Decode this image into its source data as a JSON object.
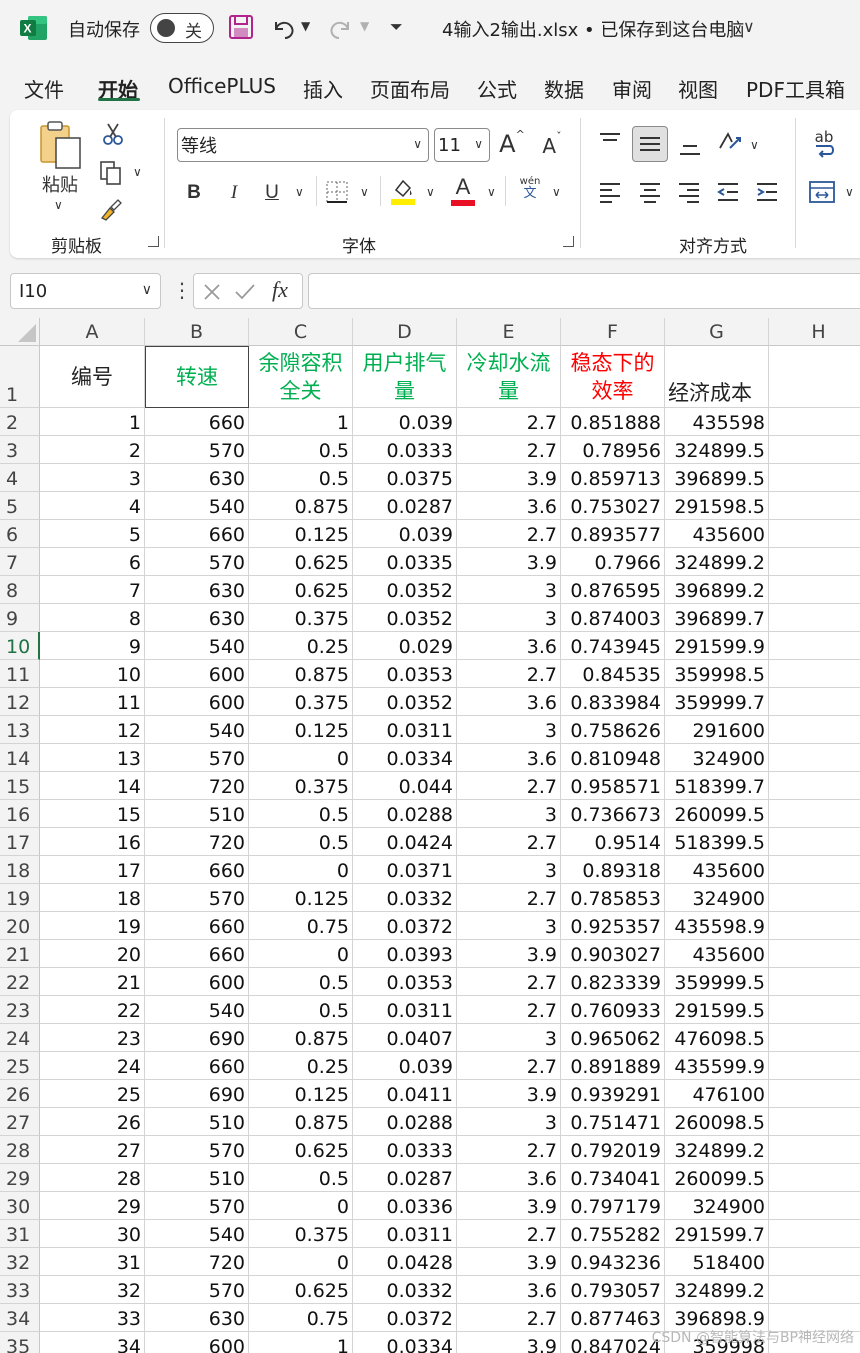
{
  "titlebar": {
    "autosave_label": "自动保存",
    "autosave_state": "关",
    "document_title": "4输入2输出.xlsx • 已保存到这台电脑"
  },
  "tabs": [
    {
      "label": "文件",
      "active": false
    },
    {
      "label": "开始",
      "active": true
    },
    {
      "label": "OfficePLUS",
      "active": false
    },
    {
      "label": "插入",
      "active": false
    },
    {
      "label": "页面布局",
      "active": false
    },
    {
      "label": "公式",
      "active": false
    },
    {
      "label": "数据",
      "active": false
    },
    {
      "label": "审阅",
      "active": false
    },
    {
      "label": "视图",
      "active": false
    },
    {
      "label": "PDF工具箱",
      "active": false
    }
  ],
  "ribbon": {
    "paste_label": "粘贴",
    "clipboard_label": "剪贴板",
    "font_group_label": "字体",
    "align_group_label": "对齐方式",
    "font_name": "等线",
    "font_size": "11",
    "bold": "B",
    "italic": "I",
    "underline": "U",
    "phonetic_top": "wén",
    "phonetic_bottom": "文",
    "font_color_letter": "A",
    "grow_font": "A",
    "shrink_font": "A",
    "wrap_ab": "ab",
    "colors": {
      "highlight": "#ffee00",
      "font_color": "#e81123"
    }
  },
  "formula_bar": {
    "name_box": "I10",
    "fx": "fx",
    "formula": ""
  },
  "columns": [
    "A",
    "B",
    "C",
    "D",
    "E",
    "F",
    "G",
    "H"
  ],
  "header_row": {
    "row_number": "1",
    "cells": [
      {
        "text": "编号",
        "color": "#222222"
      },
      {
        "text": "转速",
        "color": "#00b050"
      },
      {
        "text": "余隙容积全关",
        "color": "#00b050"
      },
      {
        "text": "用户排气量",
        "color": "#00b050"
      },
      {
        "text": "冷却水流量",
        "color": "#00b050"
      },
      {
        "text": "稳态下的效率",
        "color": "#ff0000"
      },
      {
        "text": "经济成本",
        "color": "#222222"
      }
    ]
  },
  "selected_row": "10",
  "rows": [
    [
      "2",
      "1",
      "660",
      "1",
      "0.039",
      "2.7",
      "0.851888",
      "435598"
    ],
    [
      "3",
      "2",
      "570",
      "0.5",
      "0.0333",
      "2.7",
      "0.78956",
      "324899.5"
    ],
    [
      "4",
      "3",
      "630",
      "0.5",
      "0.0375",
      "3.9",
      "0.859713",
      "396899.5"
    ],
    [
      "5",
      "4",
      "540",
      "0.875",
      "0.0287",
      "3.6",
      "0.753027",
      "291598.5"
    ],
    [
      "6",
      "5",
      "660",
      "0.125",
      "0.039",
      "2.7",
      "0.893577",
      "435600"
    ],
    [
      "7",
      "6",
      "570",
      "0.625",
      "0.0335",
      "3.9",
      "0.7966",
      "324899.2"
    ],
    [
      "8",
      "7",
      "630",
      "0.625",
      "0.0352",
      "3",
      "0.876595",
      "396899.2"
    ],
    [
      "9",
      "8",
      "630",
      "0.375",
      "0.0352",
      "3",
      "0.874003",
      "396899.7"
    ],
    [
      "10",
      "9",
      "540",
      "0.25",
      "0.029",
      "3.6",
      "0.743945",
      "291599.9"
    ],
    [
      "11",
      "10",
      "600",
      "0.875",
      "0.0353",
      "2.7",
      "0.84535",
      "359998.5"
    ],
    [
      "12",
      "11",
      "600",
      "0.375",
      "0.0352",
      "3.6",
      "0.833984",
      "359999.7"
    ],
    [
      "13",
      "12",
      "540",
      "0.125",
      "0.0311",
      "3",
      "0.758626",
      "291600"
    ],
    [
      "14",
      "13",
      "570",
      "0",
      "0.0334",
      "3.6",
      "0.810948",
      "324900"
    ],
    [
      "15",
      "14",
      "720",
      "0.375",
      "0.044",
      "2.7",
      "0.958571",
      "518399.7"
    ],
    [
      "16",
      "15",
      "510",
      "0.5",
      "0.0288",
      "3",
      "0.736673",
      "260099.5"
    ],
    [
      "17",
      "16",
      "720",
      "0.5",
      "0.0424",
      "2.7",
      "0.9514",
      "518399.5"
    ],
    [
      "18",
      "17",
      "660",
      "0",
      "0.0371",
      "3",
      "0.89318",
      "435600"
    ],
    [
      "19",
      "18",
      "570",
      "0.125",
      "0.0332",
      "2.7",
      "0.785853",
      "324900"
    ],
    [
      "20",
      "19",
      "660",
      "0.75",
      "0.0372",
      "3",
      "0.925357",
      "435598.9"
    ],
    [
      "21",
      "20",
      "660",
      "0",
      "0.0393",
      "3.9",
      "0.903027",
      "435600"
    ],
    [
      "22",
      "21",
      "600",
      "0.5",
      "0.0353",
      "2.7",
      "0.823339",
      "359999.5"
    ],
    [
      "23",
      "22",
      "540",
      "0.5",
      "0.0311",
      "2.7",
      "0.760933",
      "291599.5"
    ],
    [
      "24",
      "23",
      "690",
      "0.875",
      "0.0407",
      "3",
      "0.965062",
      "476098.5"
    ],
    [
      "25",
      "24",
      "660",
      "0.25",
      "0.039",
      "2.7",
      "0.891889",
      "435599.9"
    ],
    [
      "26",
      "25",
      "690",
      "0.125",
      "0.0411",
      "3.9",
      "0.939291",
      "476100"
    ],
    [
      "27",
      "26",
      "510",
      "0.875",
      "0.0288",
      "3",
      "0.751471",
      "260098.5"
    ],
    [
      "28",
      "27",
      "570",
      "0.625",
      "0.0333",
      "2.7",
      "0.792019",
      "324899.2"
    ],
    [
      "29",
      "28",
      "510",
      "0.5",
      "0.0287",
      "3.6",
      "0.734041",
      "260099.5"
    ],
    [
      "30",
      "29",
      "570",
      "0",
      "0.0336",
      "3.9",
      "0.797179",
      "324900"
    ],
    [
      "31",
      "30",
      "540",
      "0.375",
      "0.0311",
      "2.7",
      "0.755282",
      "291599.7"
    ],
    [
      "32",
      "31",
      "720",
      "0",
      "0.0428",
      "3.9",
      "0.943236",
      "518400"
    ],
    [
      "33",
      "32",
      "570",
      "0.625",
      "0.0332",
      "3.6",
      "0.793057",
      "324899.2"
    ],
    [
      "34",
      "33",
      "630",
      "0.75",
      "0.0372",
      "2.7",
      "0.877463",
      "396898.9"
    ],
    [
      "35",
      "34",
      "600",
      "1",
      "0.0334",
      "3.9",
      "0.847024",
      "359998"
    ]
  ],
  "watermark": "CSDN @智能算法与BP神经网络"
}
